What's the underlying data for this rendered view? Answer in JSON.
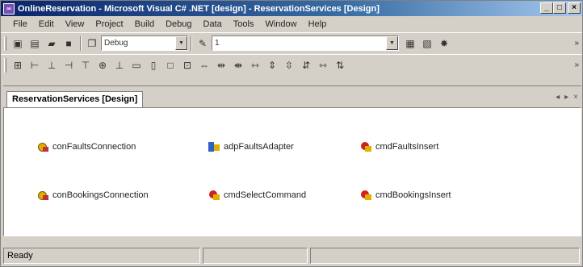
{
  "window": {
    "title": "OnlineReservation - Microsoft Visual C# .NET [design] - ReservationServices [Design]",
    "app_icon": "vs-icon"
  },
  "caption": {
    "minimize": "_",
    "maximize": "□",
    "close": "×"
  },
  "menu": [
    "File",
    "Edit",
    "View",
    "Project",
    "Build",
    "Debug",
    "Data",
    "Tools",
    "Window",
    "Help"
  ],
  "toolbar": {
    "config_combo_value": "Debug",
    "find_combo_value": "1"
  },
  "document_tab": {
    "label": "ReservationServices [Design]",
    "nav_left": "◂",
    "nav_right": "▸",
    "close": "×"
  },
  "components": [
    {
      "name": "conFaultsConnection",
      "icon": "connection-icon"
    },
    {
      "name": "adpFaultsAdapter",
      "icon": "adapter-icon"
    },
    {
      "name": "cmdFaultsInsert",
      "icon": "command-icon"
    },
    {
      "name": "conBookingsConnection",
      "icon": "connection-icon"
    },
    {
      "name": "cmdSelectCommand",
      "icon": "command-icon"
    },
    {
      "name": "cmdBookingsInsert",
      "icon": "command-icon"
    }
  ],
  "status": {
    "text": "Ready",
    "panel2": "",
    "panel3": ""
  }
}
